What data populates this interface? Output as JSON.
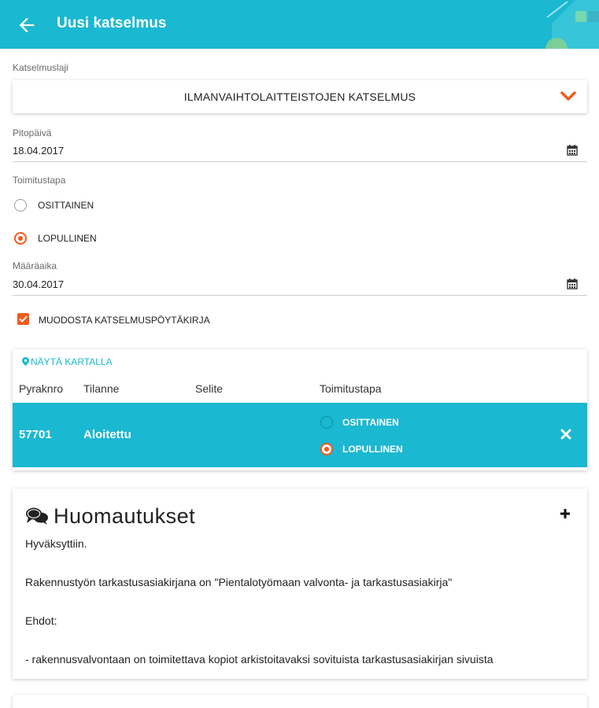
{
  "colors": {
    "primary": "#1ab8d1",
    "accent": "#f05a1a"
  },
  "appbar": {
    "title": "Uusi katselmus",
    "back_icon": "arrow-left-icon"
  },
  "form": {
    "type_label": "Katselmuslaji",
    "type_value": "ILMANVAIHTOLAITTEISTOJEN KATSELMUS",
    "date_label": "Pitopäivä",
    "date_value": "18.04.2017",
    "method_label": "Toimitustapa",
    "method_options": [
      {
        "label": "OSITTAINEN",
        "selected": false
      },
      {
        "label": "LOPULLINEN",
        "selected": true
      }
    ],
    "deadline_label": "Määräaika",
    "deadline_value": "30.04.2017",
    "protocol_checkbox": {
      "label": "MUODOSTA KATSELMUSPÖYTÄKIRJA",
      "checked": true
    }
  },
  "table": {
    "map_link": "NÄYTÄ KARTALLA",
    "headers": [
      "Pyraknro",
      "Tilanne",
      "Selite",
      "Toimitustapa"
    ],
    "rows": [
      {
        "number": "57701",
        "status": "Aloitettu",
        "description": "",
        "options": [
          {
            "label": "OSITTAINEN",
            "selected": false
          },
          {
            "label": "LOPULLINEN",
            "selected": true
          }
        ]
      }
    ]
  },
  "notes": {
    "title": "Huomautukset",
    "lines": [
      "Hyväksyttiin.",
      "Rakennustyön tarkastusasiakirjana on \"Pientalotyömaan valvonta- ja tarkastusasiakirja\"",
      "Ehdot:",
      "- rakennusvalvontaan on toimitettava kopiot arkistoitavaksi sovituista tarkastusasiakirjan sivuista"
    ]
  }
}
